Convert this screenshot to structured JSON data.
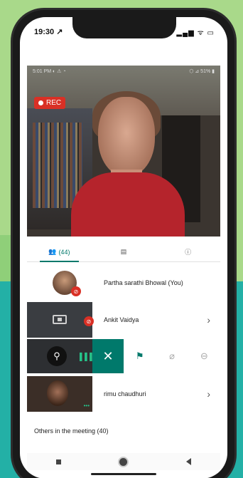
{
  "status_bar": {
    "time": "19:30 ↗",
    "icons": "▂▄▆ ᯤ ▭"
  },
  "video": {
    "status_left": "5:01 PM ◐ ⚠ ◔",
    "status_right": "⬡ ⊿ 51% ▮",
    "rec_label": "REC"
  },
  "tabs": [
    {
      "label": "(44)",
      "icon": "people-icon"
    },
    {
      "label": "",
      "icon": "chat-icon"
    },
    {
      "label": "",
      "icon": "info-icon"
    }
  ],
  "participants": [
    {
      "name": "Partha sarathi Bhowal (You)"
    },
    {
      "name": "Ankit Vaidya"
    },
    {
      "name": "rimu chaudhuri"
    }
  ],
  "actions": {
    "close": "✕",
    "pin": "📌",
    "mute": "🎙",
    "remove": "⊖"
  },
  "others_label": "Others in the meeting (40)"
}
